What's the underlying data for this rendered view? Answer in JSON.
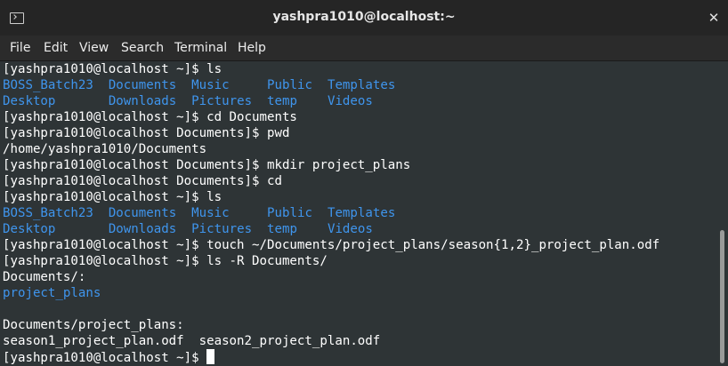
{
  "window": {
    "title": "yashpra1010@localhost:~",
    "close_glyph": "✕"
  },
  "menu": [
    "File",
    "Edit",
    "View",
    "Search",
    "Terminal",
    "Help"
  ],
  "colors": {
    "background": "#2e3436",
    "text": "#ffffff",
    "directory": "#3f95ed",
    "titlebar": "#252525"
  },
  "terminal": {
    "lines": [
      [
        {
          "t": "[yashpra1010@localhost ~]$ ls"
        }
      ],
      [
        {
          "t": "BOSS_Batch23",
          "c": "dir"
        },
        {
          "t": "  "
        },
        {
          "t": "Documents",
          "c": "dir"
        },
        {
          "t": "  "
        },
        {
          "t": "Music",
          "c": "dir"
        },
        {
          "t": "     "
        },
        {
          "t": "Public",
          "c": "dir"
        },
        {
          "t": "  "
        },
        {
          "t": "Templates",
          "c": "dir"
        }
      ],
      [
        {
          "t": "Desktop",
          "c": "dir"
        },
        {
          "t": "       "
        },
        {
          "t": "Downloads",
          "c": "dir"
        },
        {
          "t": "  "
        },
        {
          "t": "Pictures",
          "c": "dir"
        },
        {
          "t": "  "
        },
        {
          "t": "temp",
          "c": "dir"
        },
        {
          "t": "    "
        },
        {
          "t": "Videos",
          "c": "dir"
        }
      ],
      [
        {
          "t": "[yashpra1010@localhost ~]$ cd Documents"
        }
      ],
      [
        {
          "t": "[yashpra1010@localhost Documents]$ pwd"
        }
      ],
      [
        {
          "t": "/home/yashpra1010/Documents"
        }
      ],
      [
        {
          "t": "[yashpra1010@localhost Documents]$ mkdir project_plans"
        }
      ],
      [
        {
          "t": "[yashpra1010@localhost Documents]$ cd"
        }
      ],
      [
        {
          "t": "[yashpra1010@localhost ~]$ ls"
        }
      ],
      [
        {
          "t": "BOSS_Batch23",
          "c": "dir"
        },
        {
          "t": "  "
        },
        {
          "t": "Documents",
          "c": "dir"
        },
        {
          "t": "  "
        },
        {
          "t": "Music",
          "c": "dir"
        },
        {
          "t": "     "
        },
        {
          "t": "Public",
          "c": "dir"
        },
        {
          "t": "  "
        },
        {
          "t": "Templates",
          "c": "dir"
        }
      ],
      [
        {
          "t": "Desktop",
          "c": "dir"
        },
        {
          "t": "       "
        },
        {
          "t": "Downloads",
          "c": "dir"
        },
        {
          "t": "  "
        },
        {
          "t": "Pictures",
          "c": "dir"
        },
        {
          "t": "  "
        },
        {
          "t": "temp",
          "c": "dir"
        },
        {
          "t": "    "
        },
        {
          "t": "Videos",
          "c": "dir"
        }
      ],
      [
        {
          "t": "[yashpra1010@localhost ~]$ touch ~/Documents/project_plans/season{1,2}_project_plan.odf"
        }
      ],
      [
        {
          "t": "[yashpra1010@localhost ~]$ ls -R Documents/"
        }
      ],
      [
        {
          "t": "Documents/:"
        }
      ],
      [
        {
          "t": "project_plans",
          "c": "dir"
        }
      ],
      [
        {
          "t": ""
        }
      ],
      [
        {
          "t": "Documents/project_plans:"
        }
      ],
      [
        {
          "t": "season1_project_plan.odf  season2_project_plan.odf"
        }
      ],
      [
        {
          "t": "[yashpra1010@localhost ~]$ "
        },
        {
          "cursor": true
        }
      ]
    ]
  }
}
